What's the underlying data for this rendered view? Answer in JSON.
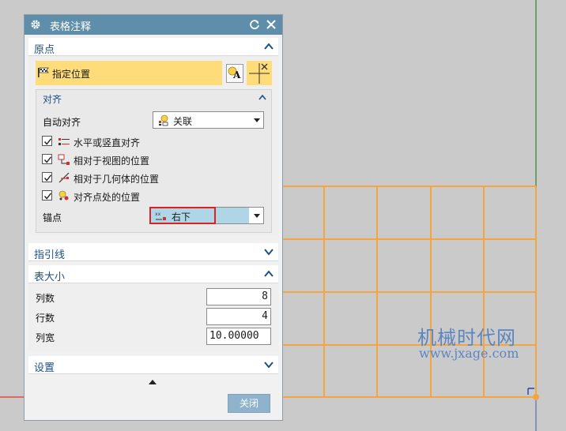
{
  "dialog": {
    "title": "表格注释",
    "icons": {
      "title": "gear-icon",
      "reset": "reset-icon",
      "close": "close-icon"
    }
  },
  "origin": {
    "section_label": "原点",
    "specify_location_label": "指定位置",
    "icons": [
      "flag-icon",
      "font-style-icon",
      "origin-tool-icon"
    ]
  },
  "alignment": {
    "section_label": "对齐",
    "auto_align_label": "自动对齐",
    "auto_align_value": "关联",
    "options": [
      {
        "label": "水平或竖直对齐",
        "checked": true,
        "icon": "horizontal-vertical-align-icon"
      },
      {
        "label": "相对于视图的位置",
        "checked": true,
        "icon": "relative-to-view-icon"
      },
      {
        "label": "相对于几何体的位置",
        "checked": true,
        "icon": "relative-to-geometry-icon"
      },
      {
        "label": "对齐点处的位置",
        "checked": true,
        "icon": "point-align-icon"
      }
    ],
    "anchor_label": "锚点",
    "anchor_value": "右下"
  },
  "leader": {
    "section_label": "指引线"
  },
  "table_size": {
    "section_label": "表大小",
    "columns_label": "列数",
    "columns_value": "8",
    "rows_label": "行数",
    "rows_value": "4",
    "column_width_label": "列宽",
    "column_width_value": "10.00000"
  },
  "settings": {
    "section_label": "设置"
  },
  "footer": {
    "close_label": "关闭"
  },
  "watermark": {
    "title": "机械时代网",
    "url": "www.jxage.com"
  },
  "colors": {
    "title_bar": "#5f8eaa",
    "section_label": "#1f4f86",
    "highlight": "#fedc79",
    "table_lines": "#f5a442",
    "axis_red": "#e04b3f",
    "axis_green": "#3d8a3d",
    "anchor_highlight": "#e02020",
    "anchor_selected_bg": "#aed6e6",
    "watermark": "#5b86c2"
  }
}
